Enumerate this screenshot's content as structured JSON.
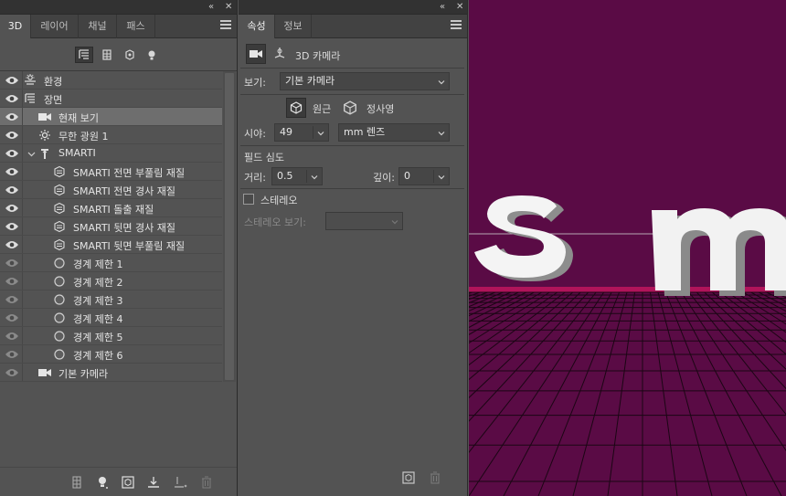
{
  "panel3d": {
    "tabs": [
      {
        "label": "3D",
        "active": true
      },
      {
        "label": "레이어",
        "active": false
      },
      {
        "label": "채널",
        "active": false
      },
      {
        "label": "패스",
        "active": false
      }
    ],
    "tree": [
      {
        "label": "환경",
        "icon": "environment-icon",
        "indent": 0,
        "visible": true,
        "selected": false
      },
      {
        "label": "장면",
        "icon": "scene-icon",
        "indent": 0,
        "visible": true,
        "selected": false
      },
      {
        "label": "현재 보기",
        "icon": "camera-icon",
        "indent": 1,
        "visible": true,
        "selected": true
      },
      {
        "label": "무한 광원 1",
        "icon": "infinite-light-icon",
        "indent": 1,
        "visible": true,
        "selected": false
      },
      {
        "label": "SMARTI",
        "icon": "mesh-icon",
        "indent": 1,
        "visible": true,
        "selected": false,
        "expanded": true
      },
      {
        "label": "SMARTI 전면 부풀림 재질",
        "icon": "material-icon",
        "indent": 2,
        "visible": true,
        "selected": false
      },
      {
        "label": "SMARTI 전면 경사 재질",
        "icon": "material-icon",
        "indent": 2,
        "visible": true,
        "selected": false
      },
      {
        "label": "SMARTI 돌출 재질",
        "icon": "material-icon",
        "indent": 2,
        "visible": true,
        "selected": false
      },
      {
        "label": "SMARTI 뒷면 경사 재질",
        "icon": "material-icon",
        "indent": 2,
        "visible": true,
        "selected": false
      },
      {
        "label": "SMARTI 뒷면 부풀림 재질",
        "icon": "material-icon",
        "indent": 2,
        "visible": true,
        "selected": false
      },
      {
        "label": "경계 제한 1",
        "icon": "boundary-icon",
        "indent": 2,
        "visible": false,
        "selected": false
      },
      {
        "label": "경계 제한 2",
        "icon": "boundary-icon",
        "indent": 2,
        "visible": false,
        "selected": false
      },
      {
        "label": "경계 제한 3",
        "icon": "boundary-icon",
        "indent": 2,
        "visible": false,
        "selected": false
      },
      {
        "label": "경계 제한 4",
        "icon": "boundary-icon",
        "indent": 2,
        "visible": false,
        "selected": false
      },
      {
        "label": "경계 제한 5",
        "icon": "boundary-icon",
        "indent": 2,
        "visible": false,
        "selected": false
      },
      {
        "label": "경계 제한 6",
        "icon": "boundary-icon",
        "indent": 2,
        "visible": false,
        "selected": false
      },
      {
        "label": "기본 카메라",
        "icon": "camera-icon",
        "indent": 1,
        "visible": false,
        "selected": false
      }
    ]
  },
  "props": {
    "tabs": [
      {
        "label": "속성",
        "active": true
      },
      {
        "label": "정보",
        "active": false
      }
    ],
    "header_title": "3D 카메라",
    "view_label": "보기:",
    "view_value": "기본 카메라",
    "perspective_label": "원근",
    "orthographic_label": "정사영",
    "fov_label": "시야:",
    "fov_value": "49",
    "lens_value": "mm 렌즈",
    "dof_title": "필드 심도",
    "distance_label": "거리:",
    "distance_value": "0.5",
    "depth_label": "깊이:",
    "depth_value": "0",
    "stereo_label": "스테레오",
    "stereo_view_label": "스테레오 보기:",
    "stereo_view_value": ""
  },
  "viewport": {
    "text": "SMARTI",
    "bg_color": "#5a0b45",
    "grid_color": "#1b0614"
  },
  "colors": {
    "panel_bg": "#535353",
    "selected_row": "#6e6e6e",
    "tab_bar": "#424242"
  }
}
